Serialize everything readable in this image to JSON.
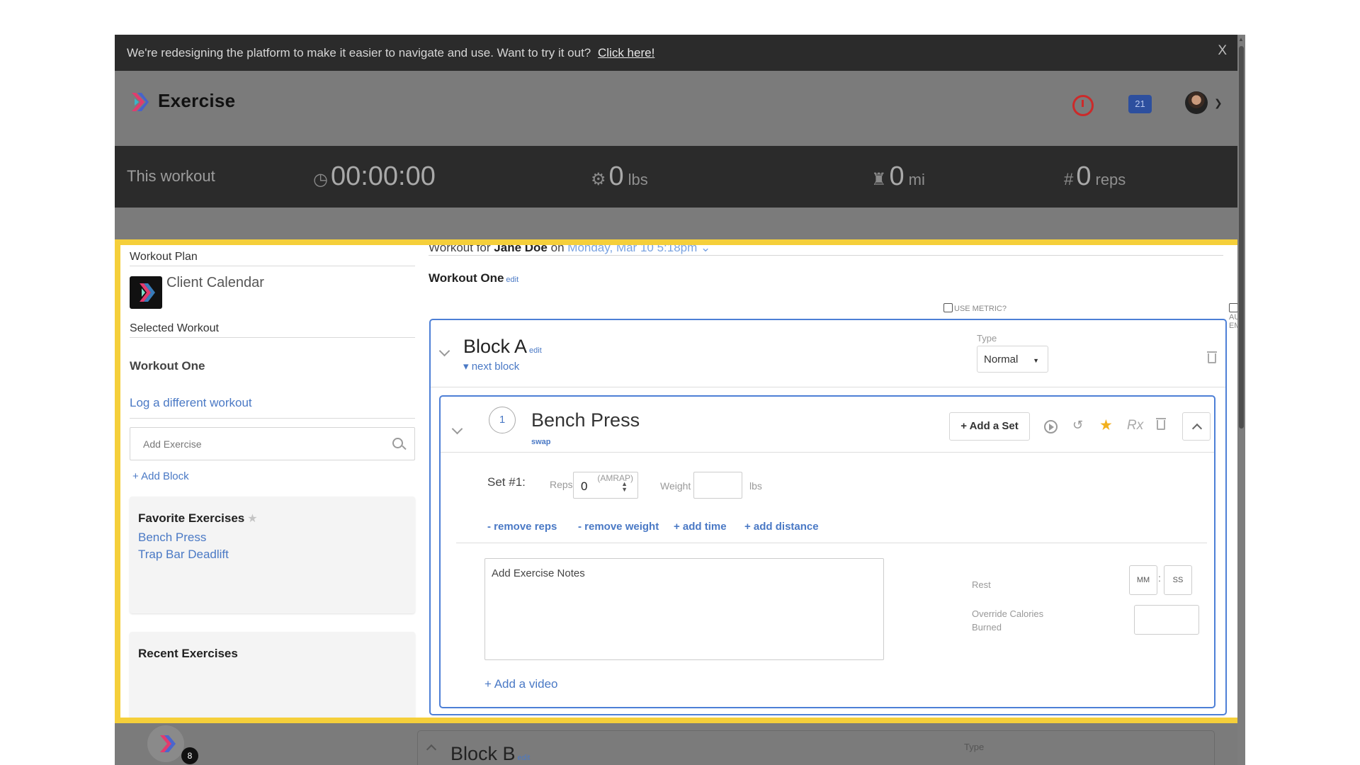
{
  "banner": {
    "message": "We're redesigning the platform to make it easier to navigate and use. Want to try it out?",
    "link": "Click here!",
    "close": "X"
  },
  "header": {
    "title": "Exercise",
    "calendar_count": "21"
  },
  "stats": {
    "label": "This workout",
    "time": "00:00:00",
    "weight_value": "0",
    "weight_unit": "lbs",
    "distance_value": "0",
    "distance_unit": "mi",
    "reps_prefix": "#",
    "reps_value": "0",
    "reps_unit": "reps"
  },
  "sidebar": {
    "workout_plan_title": "Workout Plan",
    "client_calendar": "Client Calendar",
    "selected_workout_title": "Selected Workout",
    "selected_workout_name": "Workout One",
    "log_different": "Log a different workout",
    "add_exercise_placeholder": "Add Exercise",
    "add_block": "+ Add Block",
    "favorites": {
      "title": "Favorite Exercises",
      "items": [
        "Bench Press",
        "Trap Bar Deadlift"
      ]
    },
    "recent": {
      "title": "Recent Exercises"
    }
  },
  "main": {
    "workout_for_prefix": "Workout for",
    "client_name": "Jane Doe",
    "on_word": "on",
    "date": "Monday, Mar 10 5:18pm",
    "workout_title": "Workout One",
    "edit": "edit",
    "use_metric": "USE METRIC?",
    "autofill_empty": "AUTOFILL EMPTY?",
    "block_a": {
      "title": "Block A",
      "next_block": "next block",
      "type_label": "Type",
      "type_value": "Normal"
    },
    "exercise": {
      "number": "1",
      "name": "Bench Press",
      "swap": "swap",
      "add_set": "+ Add a Set",
      "rx": "Rx",
      "set_label": "Set #1:",
      "reps_label": "Reps",
      "reps_value": "0",
      "amrap": "(AMRAP)",
      "weight_label": "Weight",
      "weight_unit": "lbs",
      "remove_reps": "- remove reps",
      "remove_weight": "- remove weight",
      "add_time": "+ add time",
      "add_distance": "+ add distance",
      "notes_placeholder": "Add Exercise Notes",
      "rest_label": "Rest",
      "mm": "MM",
      "ss": "SS",
      "colon": ":",
      "override_calories": "Override Calories Burned",
      "add_video": "+ Add a video"
    },
    "block_b": {
      "title": "Block B",
      "type_label": "Type"
    }
  },
  "chat": {
    "badge": "8"
  },
  "colors": {
    "accent": "#4a79c5",
    "highlight": "#f5cf3a",
    "block_border": "#4d7fd6",
    "star": "#f2b01e",
    "timer": "#cc2a2a"
  }
}
